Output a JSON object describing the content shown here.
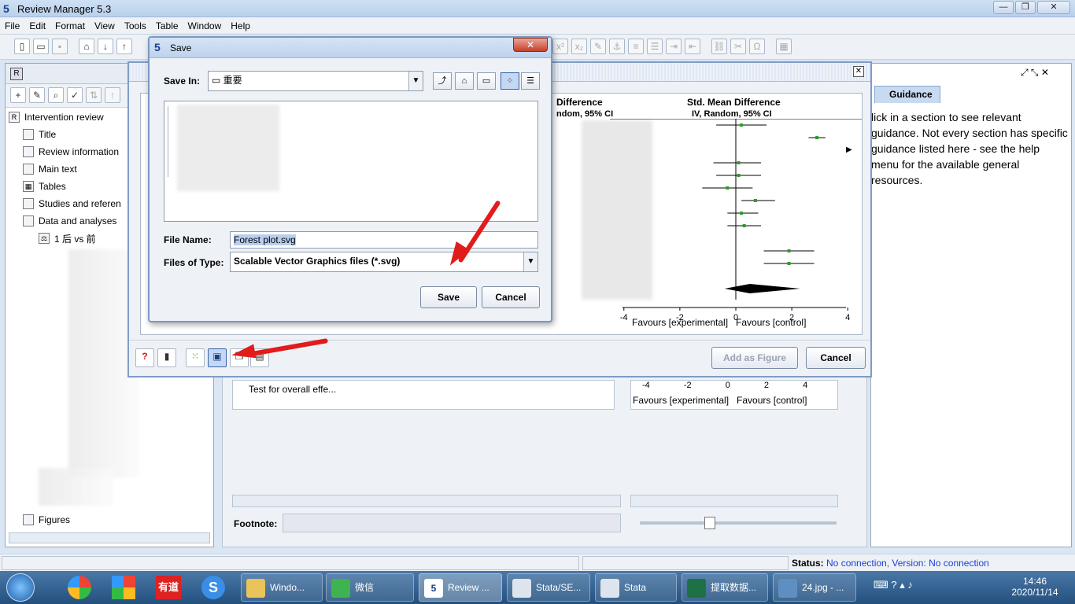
{
  "window": {
    "title": "Review Manager 5.3",
    "icon_glyph": "5"
  },
  "menu": [
    "File",
    "Edit",
    "Format",
    "View",
    "Tools",
    "Table",
    "Window",
    "Help"
  ],
  "tree": {
    "root": "Intervention review",
    "items": [
      "Title",
      "Review information",
      "Main text",
      "Tables",
      "Studies and referen",
      "Data and analyses",
      "1 后 vs 前",
      "Figures"
    ]
  },
  "guidance": {
    "tab": "Guidance",
    "text": "lick in a section to see relevant guidance. Not every section has specific guidance listed here - see the help menu for the available general resources."
  },
  "plot": {
    "header_left": "Difference",
    "header_left2": "ndom, 95% CI",
    "header_right": "Std. Mean Difference",
    "header_right2": "IV, Random, 95% CI",
    "favours": "Favours [experimental]   Favours [control]",
    "add_figure": "Add as Figure",
    "cancel": "Cancel"
  },
  "chart_data": {
    "type": "scatter",
    "title": "",
    "xlabel": "Favours [experimental]   Favours [control]",
    "ylabel": "",
    "xlim": [
      -4.5,
      4.5
    ],
    "xticks": [
      "-4",
      "-2",
      "0",
      "2",
      "4"
    ],
    "series": [
      {
        "values": [
          {
            "x": 0.2,
            "lo": -0.7,
            "hi": 1.1
          },
          {
            "x": 2.9,
            "lo": 2.6,
            "hi": 3.2
          },
          {
            "x": 0.1,
            "lo": -0.8,
            "hi": 0.9
          },
          {
            "x": 0.1,
            "lo": -0.7,
            "hi": 0.9
          },
          {
            "x": -0.3,
            "lo": -1.2,
            "hi": 0.6
          },
          {
            "x": 0.7,
            "lo": 0.2,
            "hi": 1.4
          },
          {
            "x": 0.2,
            "lo": -0.3,
            "hi": 0.8
          },
          {
            "x": 0.3,
            "lo": -0.3,
            "hi": 0.9
          },
          {
            "x": 1.9,
            "lo": 1.0,
            "hi": 2.8
          },
          {
            "x": 1.9,
            "lo": 1.0,
            "hi": 2.8
          }
        ]
      }
    ],
    "pooled": {
      "x": 0.5,
      "lo": -0.4,
      "hi": 2.3
    }
  },
  "save_dialog": {
    "title": "Save",
    "save_in_label": "Save In:",
    "save_in_value": "重要",
    "file_name_label": "File Name:",
    "file_name_value": "Forest plot.svg",
    "files_of_type_label": "Files of Type:",
    "files_of_type_value": "Scalable Vector Graphics files (*.svg)",
    "save": "Save",
    "cancel": "Cancel",
    "close": "✕"
  },
  "background_table": {
    "row_label": "Test for overall effe...",
    "favours": "Favours [experimental]   Favours [control]",
    "ticks": [
      "-4",
      "-2",
      "0",
      "2",
      "4"
    ],
    "footnote_label": "Footnote:"
  },
  "status": {
    "label": "Status:",
    "value": "No connection, Version: No connection"
  },
  "taskbar": {
    "items": [
      {
        "label": "Windo...",
        "color": "#e8c45a"
      },
      {
        "label": "微信",
        "color": "#3fb34f"
      },
      {
        "label": "Review ...",
        "color": "#1a3f86"
      },
      {
        "label": "Stata/SE...",
        "color": "#23507d"
      },
      {
        "label": "Stata",
        "color": "#23507d"
      },
      {
        "label": "提取数据...",
        "color": "#1e7145"
      },
      {
        "label": "24.jpg - ...",
        "color": "#5f8fc0"
      }
    ],
    "time": "14:46",
    "date": "2020/11/14",
    "pinned_label": "有道"
  },
  "colors": {
    "accent": "#1a3f86",
    "arrow": "#e21b1b",
    "point": "#2f9b2f"
  }
}
